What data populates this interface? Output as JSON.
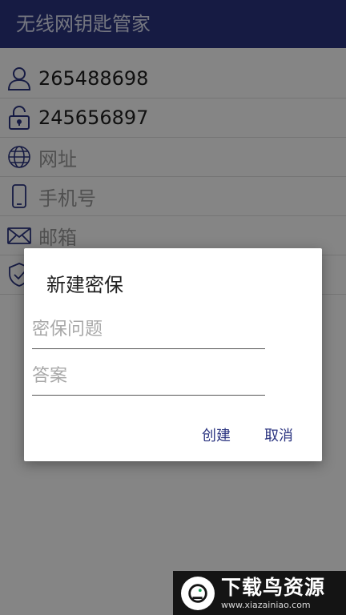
{
  "app": {
    "title": "无线网钥匙管家"
  },
  "fields": [
    {
      "icon": "user-icon",
      "value": "265488698",
      "hint": false
    },
    {
      "icon": "unlock-icon",
      "value": "245656897",
      "hint": false
    },
    {
      "icon": "globe-icon",
      "value": "网址",
      "hint": true
    },
    {
      "icon": "phone-icon",
      "value": "手机号",
      "hint": true
    },
    {
      "icon": "mail-icon",
      "value": "邮箱",
      "hint": true
    },
    {
      "icon": "shield-check-icon",
      "value": "",
      "hint": true
    }
  ],
  "dialog": {
    "title": "新建密保",
    "question_placeholder": "密保问题",
    "answer_placeholder": "答案",
    "create_label": "创建",
    "cancel_label": "取消"
  },
  "watermark": {
    "name": "下载鸟资源",
    "url": "www.xiazainiao.com"
  },
  "colors": {
    "appbar": "#2b3480",
    "accent": "#2b3480"
  }
}
